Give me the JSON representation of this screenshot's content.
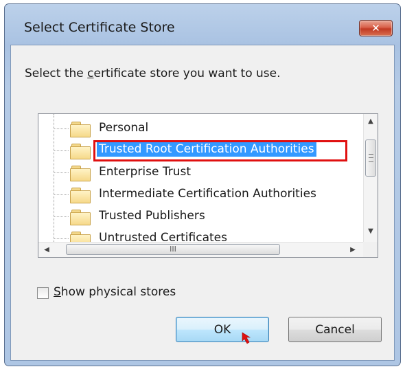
{
  "window": {
    "title": "Select Certificate Store",
    "close_glyph": "✕"
  },
  "prompt": {
    "before": "Select the ",
    "accel": "c",
    "after": "ertificate store you want to use."
  },
  "tree": {
    "items": [
      {
        "label": "Personal",
        "selected": false
      },
      {
        "label": "Trusted Root Certification Authorities",
        "selected": true
      },
      {
        "label": "Enterprise Trust",
        "selected": false
      },
      {
        "label": "Intermediate Certification Authorities",
        "selected": false
      },
      {
        "label": "Trusted Publishers",
        "selected": false
      },
      {
        "label": "Untrusted Certificates",
        "selected": false
      }
    ]
  },
  "scrollbars": {
    "up_glyph": "▲",
    "down_glyph": "▼",
    "left_glyph": "◀",
    "right_glyph": "▶",
    "hgrip": "III"
  },
  "checkbox": {
    "accel": "S",
    "rest": "how physical stores",
    "checked": false
  },
  "buttons": {
    "ok": "OK",
    "cancel": "Cancel"
  },
  "colors": {
    "selection": "#3399ff",
    "annotation": "#e01010"
  }
}
